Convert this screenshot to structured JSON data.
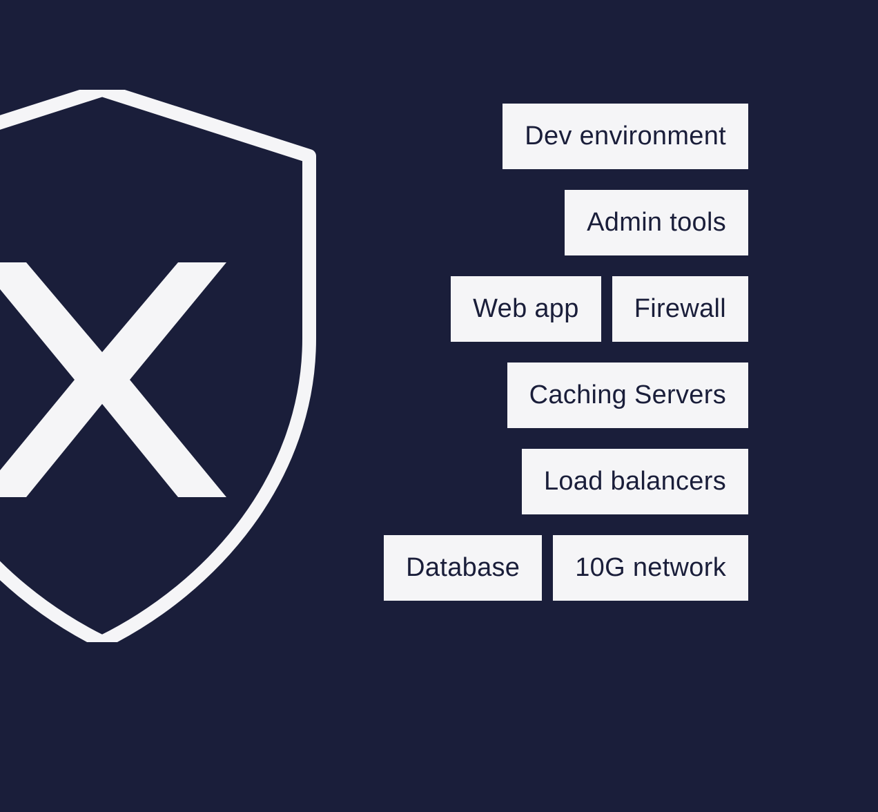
{
  "tags": {
    "row1": [
      "Dev environment"
    ],
    "row2": [
      "Admin tools"
    ],
    "row3": [
      "Web app",
      "Firewall"
    ],
    "row4": [
      "Caching Servers"
    ],
    "row5": [
      "Load balancers"
    ],
    "row6": [
      "Database",
      "10G network"
    ]
  },
  "colors": {
    "background": "#1a1e3a",
    "tag_bg": "#f5f5f7",
    "tag_text": "#1a1e3a",
    "shield": "#f5f5f7"
  }
}
